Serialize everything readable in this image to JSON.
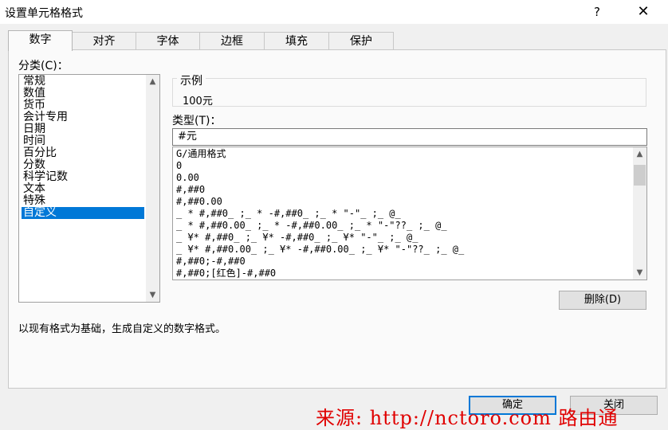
{
  "window": {
    "title": "设置单元格格式",
    "help_label": "?",
    "close_label": "✕"
  },
  "tabs": [
    {
      "label": "数字",
      "active": true
    },
    {
      "label": "对齐",
      "active": false
    },
    {
      "label": "字体",
      "active": false
    },
    {
      "label": "边框",
      "active": false
    },
    {
      "label": "填充",
      "active": false
    },
    {
      "label": "保护",
      "active": false
    }
  ],
  "category": {
    "label": "分类(C)：",
    "items": [
      "常规",
      "数值",
      "货币",
      "会计专用",
      "日期",
      "时间",
      "百分比",
      "分数",
      "科学记数",
      "文本",
      "特殊",
      "自定义"
    ],
    "selected": "自定义"
  },
  "sample": {
    "label": "示例",
    "value": "100元"
  },
  "type": {
    "label": "类型(T)：",
    "value": "#元",
    "formats": [
      "G/通用格式",
      "0",
      "0.00",
      "#,##0",
      "#,##0.00",
      "_ * #,##0_ ;_ * -#,##0_ ;_ * \"-\"_ ;_ @_",
      "_ * #,##0.00_ ;_ * -#,##0.00_ ;_ * \"-\"??_ ;_ @_",
      "_ ¥* #,##0_ ;_ ¥* -#,##0_ ;_ ¥* \"-\"_ ;_ @_",
      "_ ¥* #,##0.00_ ;_ ¥* -#,##0.00_ ;_ ¥* \"-\"??_ ;_ @_",
      "#,##0;-#,##0",
      "#,##0;[红色]-#,##0"
    ]
  },
  "buttons": {
    "delete": "删除(D)",
    "ok": "确定",
    "cancel": "关闭"
  },
  "description": "以现有格式为基础，生成自定义的数字格式。",
  "watermark": "来源: http://nctoro.com 路由通",
  "icons": {
    "scroll_up": "▲",
    "scroll_down": "▼"
  },
  "colors": {
    "selection": "#0078d7",
    "watermark": "#e00000"
  }
}
